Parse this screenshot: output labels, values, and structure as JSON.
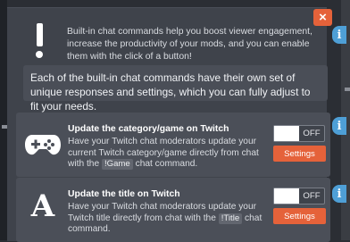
{
  "modal": {
    "close_glyph": "×",
    "intro": "Built-in chat commands help you boost viewer engagement, increase the productivity of your mods, and you can enable them with the click of a button!",
    "note": "Each of the built-in chat commands have their own set of unique responses and settings, which you can fully adjust to fit your needs."
  },
  "commands": [
    {
      "icon": "gamepad-icon",
      "title": "Update the category/game on Twitch",
      "desc_before": "Have your Twitch chat moderators update your current Twitch category/game directly from chat with the",
      "command": "!Game",
      "desc_after": "chat command.",
      "toggle_state": "OFF",
      "settings_label": "Settings",
      "info_glyph": "i"
    },
    {
      "icon": "letter-a-icon",
      "icon_text": "A",
      "title": "Update the title on Twitch",
      "desc_before": "Have your Twitch chat moderators update your Twitch title directly from chat with the",
      "command": "!Title",
      "desc_after": "chat command.",
      "toggle_state": "OFF",
      "settings_label": "Settings",
      "info_glyph": "i"
    }
  ],
  "intro_info_glyph": "i",
  "colors": {
    "accent": "#e5623a",
    "info": "#4e9fd6",
    "panel": "#3f434b",
    "card": "#4b4f58"
  }
}
